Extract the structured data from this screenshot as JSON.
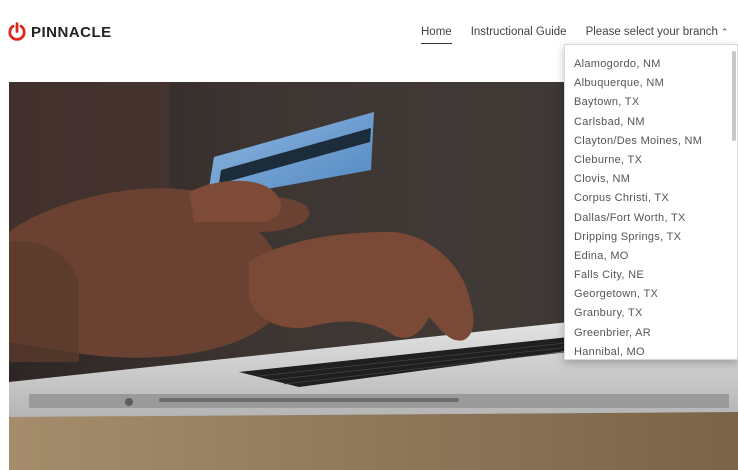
{
  "brand": {
    "name": "PINNACLE",
    "accent": "#e0251b"
  },
  "nav": {
    "home": "Home",
    "guide": "Instructional Guide",
    "branch_select": "Please select your branch"
  },
  "branches": [
    "Alamogordo, NM",
    "Albuquerque, NM",
    "Baytown, TX",
    "Carlsbad, NM",
    "Clayton/Des Moines, NM",
    "Cleburne, TX",
    "Clovis, NM",
    "Corpus Christi, TX",
    "Dallas/Fort Worth, TX",
    "Dripping Springs, TX",
    "Edina, MO",
    "Falls City, NE",
    "Georgetown, TX",
    "Granbury, TX",
    "Greenbrier, AR",
    "Hannibal, MO"
  ]
}
